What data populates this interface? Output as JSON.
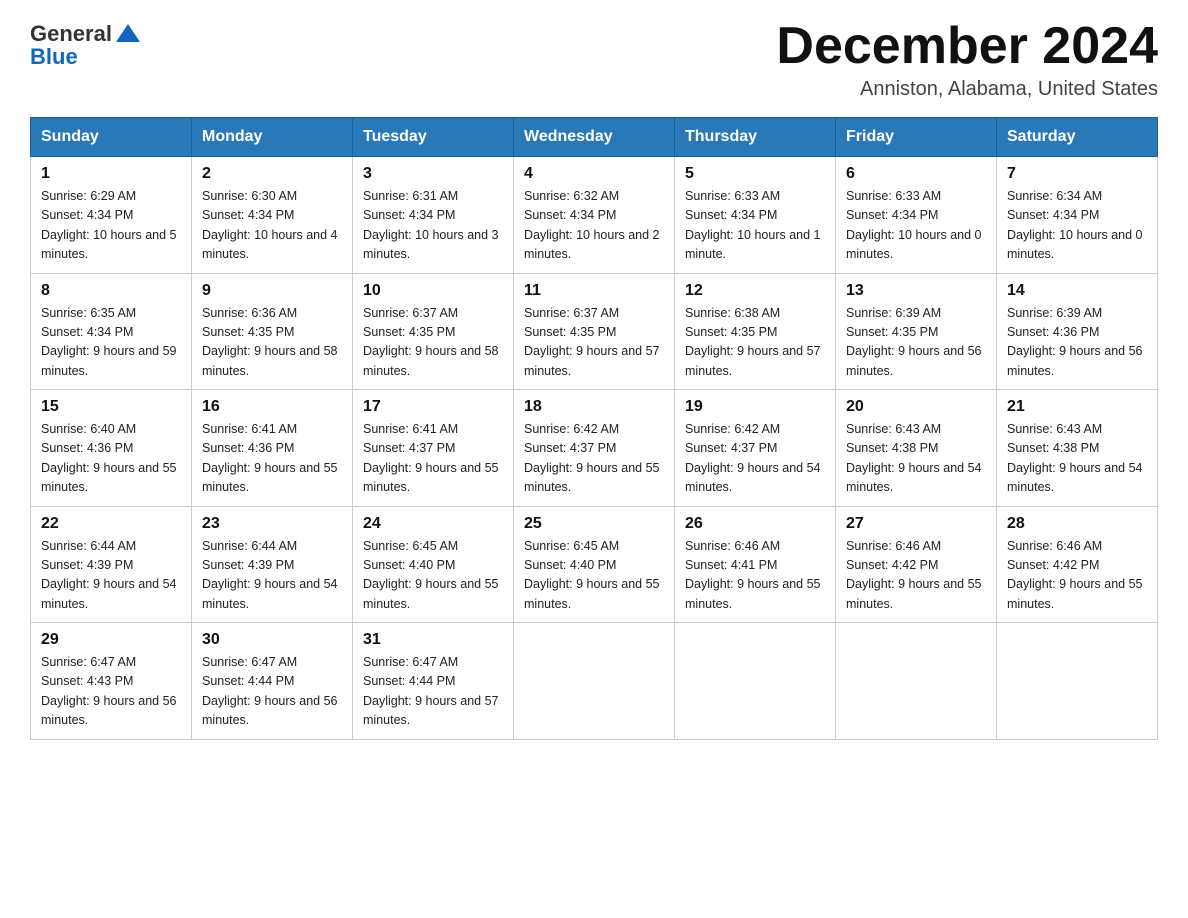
{
  "header": {
    "logo_general": "General",
    "logo_blue": "Blue",
    "month_year": "December 2024",
    "location": "Anniston, Alabama, United States"
  },
  "days_of_week": [
    "Sunday",
    "Monday",
    "Tuesday",
    "Wednesday",
    "Thursday",
    "Friday",
    "Saturday"
  ],
  "weeks": [
    [
      {
        "day": "1",
        "sunrise": "6:29 AM",
        "sunset": "4:34 PM",
        "daylight": "10 hours and 5 minutes."
      },
      {
        "day": "2",
        "sunrise": "6:30 AM",
        "sunset": "4:34 PM",
        "daylight": "10 hours and 4 minutes."
      },
      {
        "day": "3",
        "sunrise": "6:31 AM",
        "sunset": "4:34 PM",
        "daylight": "10 hours and 3 minutes."
      },
      {
        "day": "4",
        "sunrise": "6:32 AM",
        "sunset": "4:34 PM",
        "daylight": "10 hours and 2 minutes."
      },
      {
        "day": "5",
        "sunrise": "6:33 AM",
        "sunset": "4:34 PM",
        "daylight": "10 hours and 1 minute."
      },
      {
        "day": "6",
        "sunrise": "6:33 AM",
        "sunset": "4:34 PM",
        "daylight": "10 hours and 0 minutes."
      },
      {
        "day": "7",
        "sunrise": "6:34 AM",
        "sunset": "4:34 PM",
        "daylight": "10 hours and 0 minutes."
      }
    ],
    [
      {
        "day": "8",
        "sunrise": "6:35 AM",
        "sunset": "4:34 PM",
        "daylight": "9 hours and 59 minutes."
      },
      {
        "day": "9",
        "sunrise": "6:36 AM",
        "sunset": "4:35 PM",
        "daylight": "9 hours and 58 minutes."
      },
      {
        "day": "10",
        "sunrise": "6:37 AM",
        "sunset": "4:35 PM",
        "daylight": "9 hours and 58 minutes."
      },
      {
        "day": "11",
        "sunrise": "6:37 AM",
        "sunset": "4:35 PM",
        "daylight": "9 hours and 57 minutes."
      },
      {
        "day": "12",
        "sunrise": "6:38 AM",
        "sunset": "4:35 PM",
        "daylight": "9 hours and 57 minutes."
      },
      {
        "day": "13",
        "sunrise": "6:39 AM",
        "sunset": "4:35 PM",
        "daylight": "9 hours and 56 minutes."
      },
      {
        "day": "14",
        "sunrise": "6:39 AM",
        "sunset": "4:36 PM",
        "daylight": "9 hours and 56 minutes."
      }
    ],
    [
      {
        "day": "15",
        "sunrise": "6:40 AM",
        "sunset": "4:36 PM",
        "daylight": "9 hours and 55 minutes."
      },
      {
        "day": "16",
        "sunrise": "6:41 AM",
        "sunset": "4:36 PM",
        "daylight": "9 hours and 55 minutes."
      },
      {
        "day": "17",
        "sunrise": "6:41 AM",
        "sunset": "4:37 PM",
        "daylight": "9 hours and 55 minutes."
      },
      {
        "day": "18",
        "sunrise": "6:42 AM",
        "sunset": "4:37 PM",
        "daylight": "9 hours and 55 minutes."
      },
      {
        "day": "19",
        "sunrise": "6:42 AM",
        "sunset": "4:37 PM",
        "daylight": "9 hours and 54 minutes."
      },
      {
        "day": "20",
        "sunrise": "6:43 AM",
        "sunset": "4:38 PM",
        "daylight": "9 hours and 54 minutes."
      },
      {
        "day": "21",
        "sunrise": "6:43 AM",
        "sunset": "4:38 PM",
        "daylight": "9 hours and 54 minutes."
      }
    ],
    [
      {
        "day": "22",
        "sunrise": "6:44 AM",
        "sunset": "4:39 PM",
        "daylight": "9 hours and 54 minutes."
      },
      {
        "day": "23",
        "sunrise": "6:44 AM",
        "sunset": "4:39 PM",
        "daylight": "9 hours and 54 minutes."
      },
      {
        "day": "24",
        "sunrise": "6:45 AM",
        "sunset": "4:40 PM",
        "daylight": "9 hours and 55 minutes."
      },
      {
        "day": "25",
        "sunrise": "6:45 AM",
        "sunset": "4:40 PM",
        "daylight": "9 hours and 55 minutes."
      },
      {
        "day": "26",
        "sunrise": "6:46 AM",
        "sunset": "4:41 PM",
        "daylight": "9 hours and 55 minutes."
      },
      {
        "day": "27",
        "sunrise": "6:46 AM",
        "sunset": "4:42 PM",
        "daylight": "9 hours and 55 minutes."
      },
      {
        "day": "28",
        "sunrise": "6:46 AM",
        "sunset": "4:42 PM",
        "daylight": "9 hours and 55 minutes."
      }
    ],
    [
      {
        "day": "29",
        "sunrise": "6:47 AM",
        "sunset": "4:43 PM",
        "daylight": "9 hours and 56 minutes."
      },
      {
        "day": "30",
        "sunrise": "6:47 AM",
        "sunset": "4:44 PM",
        "daylight": "9 hours and 56 minutes."
      },
      {
        "day": "31",
        "sunrise": "6:47 AM",
        "sunset": "4:44 PM",
        "daylight": "9 hours and 57 minutes."
      },
      null,
      null,
      null,
      null
    ]
  ]
}
